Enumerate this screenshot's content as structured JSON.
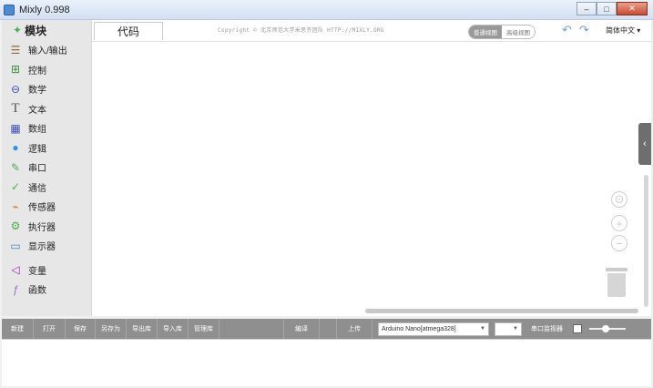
{
  "window": {
    "title": "Mixly 0.998"
  },
  "sidebar": {
    "header": "模块",
    "items": [
      {
        "label": "输入/输出",
        "icon": "io-icon",
        "color": "#8a6d3b"
      },
      {
        "label": "控制",
        "icon": "gamepad-icon",
        "color": "#3e8e41"
      },
      {
        "label": "数学",
        "icon": "math-icon",
        "color": "#3f51b5"
      },
      {
        "label": "文本",
        "icon": "text-icon",
        "color": "#555555"
      },
      {
        "label": "数组",
        "icon": "array-icon",
        "color": "#3f51b5"
      },
      {
        "label": "逻辑",
        "icon": "bulb-icon",
        "color": "#2196f3"
      },
      {
        "label": "串口",
        "icon": "pen-icon",
        "color": "#4caf50"
      },
      {
        "label": "通信",
        "icon": "signal-icon",
        "color": "#4caf50"
      },
      {
        "label": "传感器",
        "icon": "sensor-icon",
        "color": "#c57a2c"
      },
      {
        "label": "执行器",
        "icon": "actuator-icon",
        "color": "#4caf50"
      },
      {
        "label": "显示器",
        "icon": "monitor-icon",
        "color": "#3f88c5"
      },
      {
        "label": "变量",
        "icon": "variable-icon",
        "color": "#9c27b0"
      },
      {
        "label": "函数",
        "icon": "function-icon",
        "color": "#9c6fc4"
      }
    ]
  },
  "workspace": {
    "tab_label": "代码",
    "copyright": "Copyright © 北京师范大学米思齐团队 HTTP://MIXLY.ORG",
    "views": [
      "普通视图",
      "高级视图"
    ],
    "language": "简体中文"
  },
  "toolbar": {
    "buttons": [
      "新建",
      "打开",
      "保存",
      "另存为",
      "导出库",
      "导入库",
      "管理库"
    ],
    "compile": "编译",
    "upload": "上传",
    "board": "Arduino Nano[atmega328]",
    "port": "",
    "serial_monitor": "串口监视器"
  }
}
